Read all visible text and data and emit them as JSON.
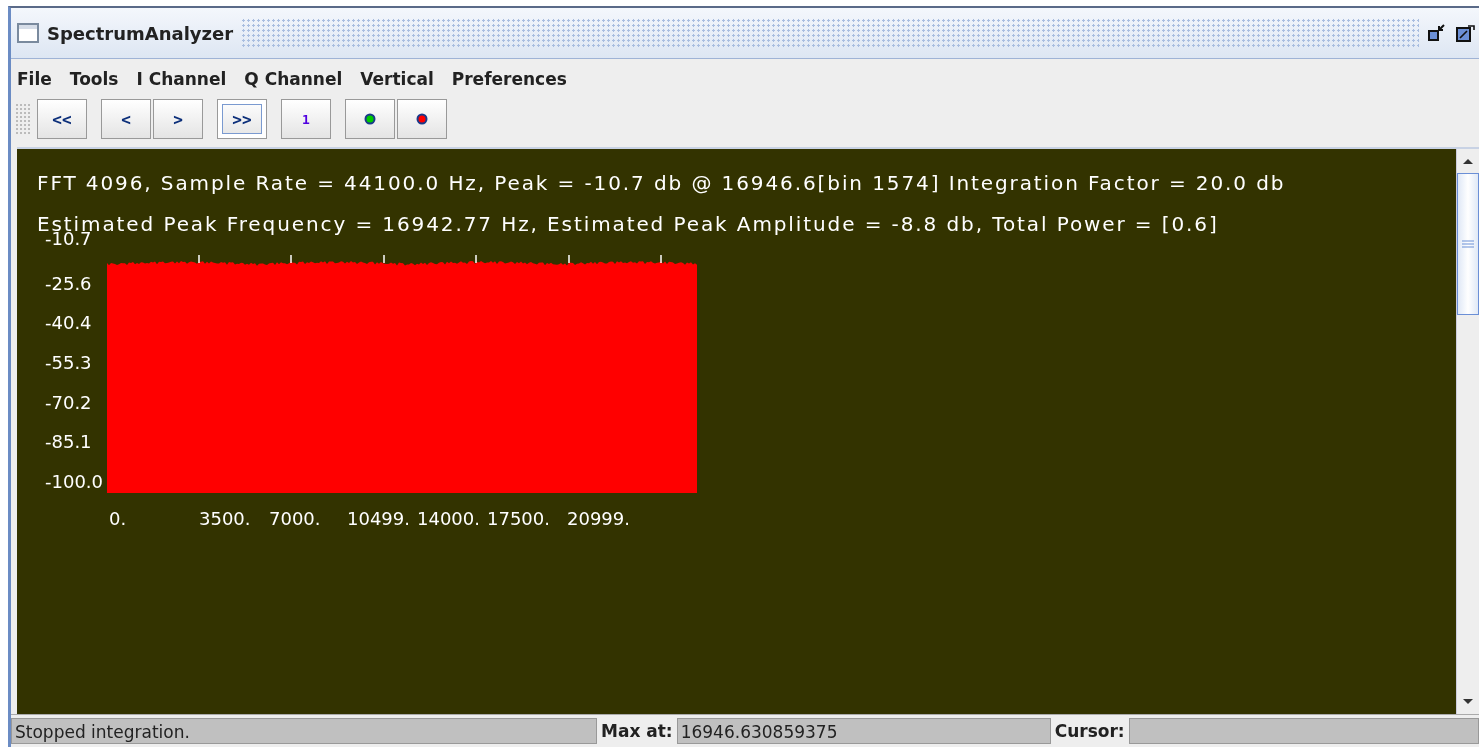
{
  "window": {
    "title": "SpectrumAnalyzer"
  },
  "menu": [
    "File",
    "Tools",
    "I Channel",
    "Q Channel",
    "Vertical",
    "Preferences"
  ],
  "toolbar": [
    {
      "kind": "text",
      "label": "<<",
      "selected": false
    },
    {
      "kind": "text",
      "label": "<",
      "selected": false
    },
    {
      "kind": "text",
      "label": ">",
      "selected": false
    },
    {
      "kind": "text",
      "label": ">>",
      "selected": true
    },
    {
      "kind": "text",
      "label": "1",
      "selected": false
    },
    {
      "kind": "dot",
      "color": "#00cc00",
      "selected": false
    },
    {
      "kind": "dot",
      "color": "#ff0000",
      "selected": false
    }
  ],
  "plot": {
    "header": [
      "FFT 4096, Sample Rate = 44100.0 Hz, Peak = -10.7 db @ 16946.6[bin 1574] Integration Factor = 20.0 db",
      "Estimated Peak Frequency = 16942.77 Hz, Estimated Peak Amplitude = -8.8 db, Total Power = [0.6]"
    ],
    "y_labels": [
      "-10.7",
      "-25.6",
      "-40.4",
      "-55.3",
      "-70.2",
      "-85.1",
      "-100.0"
    ],
    "x_labels": [
      "0.",
      "3500.",
      "7000.",
      "10499.",
      "14000.",
      "17500.",
      "20999."
    ]
  },
  "status": {
    "message": "Stopped integration.",
    "max_label": "Max at:",
    "max_value": "16946.630859375",
    "cursor_label": "Cursor:"
  }
}
